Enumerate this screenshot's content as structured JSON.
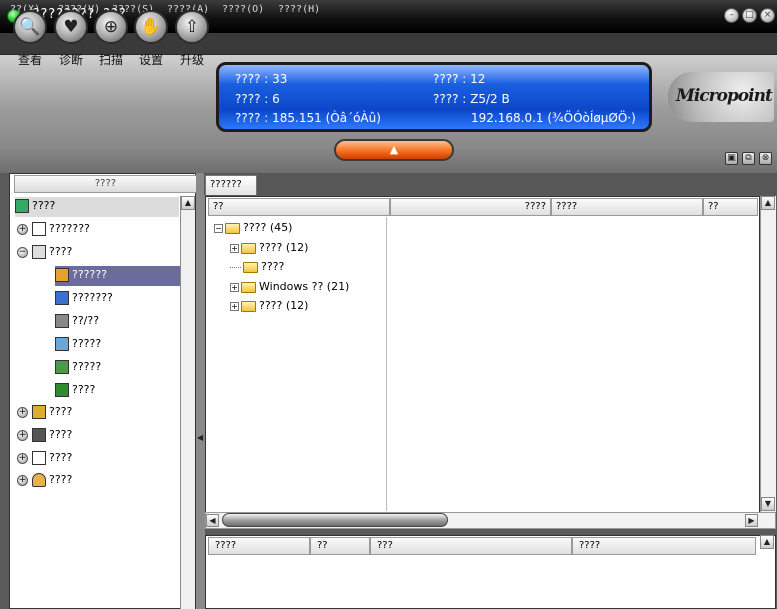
{
  "window": {
    "title": "????????  ???",
    "btn_min": "–",
    "btn_max": "□",
    "btn_close": "×"
  },
  "menu": [
    "??(X)",
    "????(V)",
    "????(S)",
    "????(A)",
    "????(O)",
    "????(H)"
  ],
  "toolbar": {
    "buttons": [
      {
        "label": "查看",
        "glyph": "🔍",
        "icon": "magnifier-icon"
      },
      {
        "label": "诊断",
        "glyph": "♥",
        "icon": "heart-icon"
      },
      {
        "label": "扫描",
        "glyph": "⊕",
        "icon": "scan-icon"
      },
      {
        "label": "设置",
        "glyph": "✋",
        "icon": "hand-icon"
      },
      {
        "label": "升级",
        "glyph": "⇧",
        "icon": "upgrade-icon"
      }
    ]
  },
  "status": {
    "l1": "???? : 33",
    "l2": "???? : 6",
    "l3": "???? : 185.151 (Òâ´óÀû)",
    "r1": "???? : 12",
    "r2": "???? : Z5/2 B",
    "r3": "192.168.0.1 (¾ÖÓòÍøµØÖ·)"
  },
  "logo": "Micropoint",
  "collapse_arrow": "▲",
  "panel_icons": [
    "▣",
    "⧉",
    "⊗"
  ],
  "left": {
    "header": "????",
    "root": "????",
    "items": [
      {
        "label": "???????",
        "expander": "+",
        "icon": "doc-icon",
        "level": 0
      },
      {
        "label": "????",
        "expander": "−",
        "icon": "monitor-icon",
        "level": 0
      },
      {
        "label": "??????",
        "icon": "process-icon",
        "level": 1,
        "selected": true
      },
      {
        "label": "???????",
        "icon": "edit-icon",
        "level": 1
      },
      {
        "label": "??/??",
        "icon": "io-icon",
        "level": 1
      },
      {
        "label": "?????",
        "icon": "network-icon",
        "level": 1
      },
      {
        "label": "?????",
        "icon": "network2-icon",
        "level": 1
      },
      {
        "label": "????",
        "icon": "chip-icon",
        "level": 1
      },
      {
        "label": "????",
        "expander": "+",
        "icon": "cards-icon",
        "level": 0
      },
      {
        "label": "????",
        "expander": "+",
        "icon": "disk-icon",
        "level": 0
      },
      {
        "label": "????",
        "expander": "+",
        "icon": "files-icon",
        "level": 0
      },
      {
        "label": "????",
        "expander": "+",
        "icon": "user-icon",
        "level": 0
      }
    ]
  },
  "right": {
    "tab": "??????",
    "columns": [
      "??",
      "????",
      "????",
      "??"
    ],
    "tree": {
      "root": "???? (45)",
      "children": [
        {
          "label": "???? (12)",
          "expander": "+"
        },
        {
          "label": "????",
          "expander": ""
        },
        {
          "label": "Windows ?? (21)",
          "expander": "+"
        },
        {
          "label": "???? (12)",
          "expander": "+"
        }
      ]
    },
    "bottom_columns": [
      "????",
      "??",
      "???",
      "????"
    ]
  }
}
